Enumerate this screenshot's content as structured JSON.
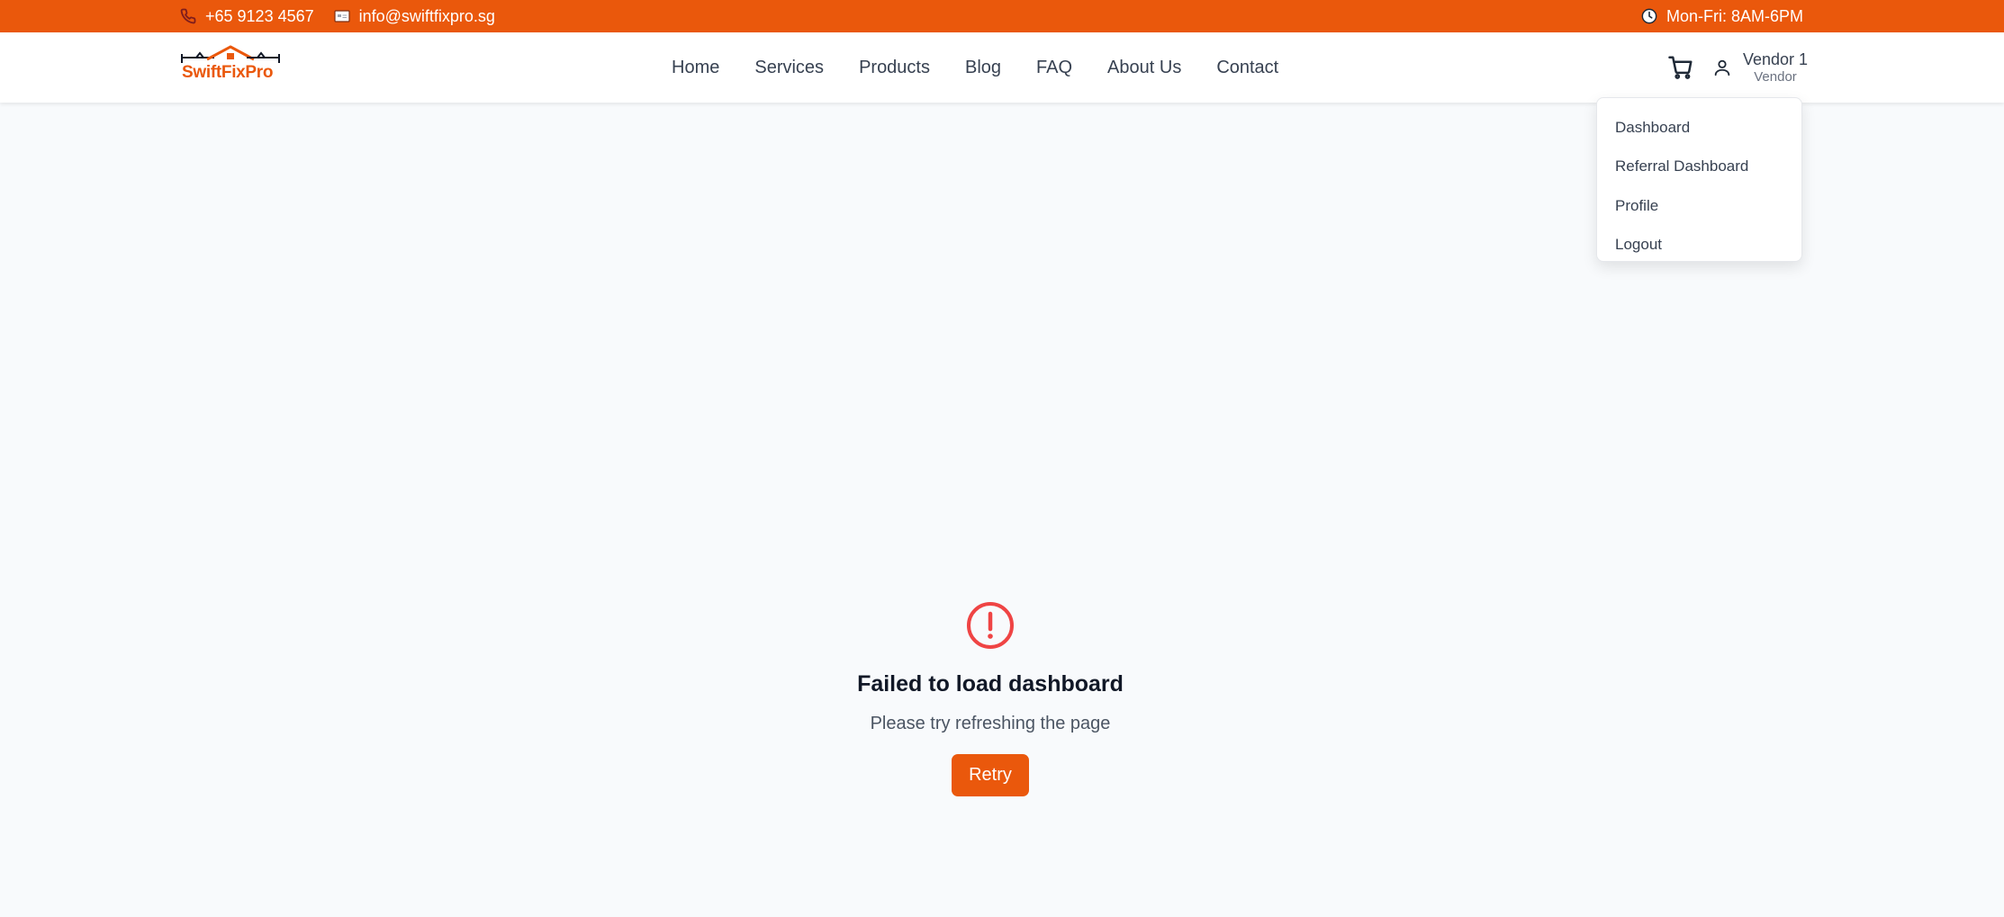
{
  "topbar": {
    "phone": "+65 9123 4567",
    "email": "info@swiftfixpro.sg",
    "hours": "Mon-Fri: 8AM-6PM"
  },
  "header": {
    "logo_text": "SwiftFixPro",
    "nav": [
      {
        "label": "Home"
      },
      {
        "label": "Services"
      },
      {
        "label": "Products"
      },
      {
        "label": "Blog"
      },
      {
        "label": "FAQ"
      },
      {
        "label": "About Us"
      },
      {
        "label": "Contact"
      }
    ],
    "user": {
      "name": "Vendor 1",
      "role": "Vendor"
    }
  },
  "dropdown": {
    "items": [
      {
        "label": "Dashboard"
      },
      {
        "label": "Referral Dashboard"
      },
      {
        "label": "Profile"
      },
      {
        "label": "Logout"
      }
    ]
  },
  "error": {
    "title": "Failed to load dashboard",
    "message": "Please try refreshing the page",
    "retry_label": "Retry"
  },
  "colors": {
    "accent": "#ea580c",
    "error": "#ef4444",
    "background": "#f8fafc"
  }
}
